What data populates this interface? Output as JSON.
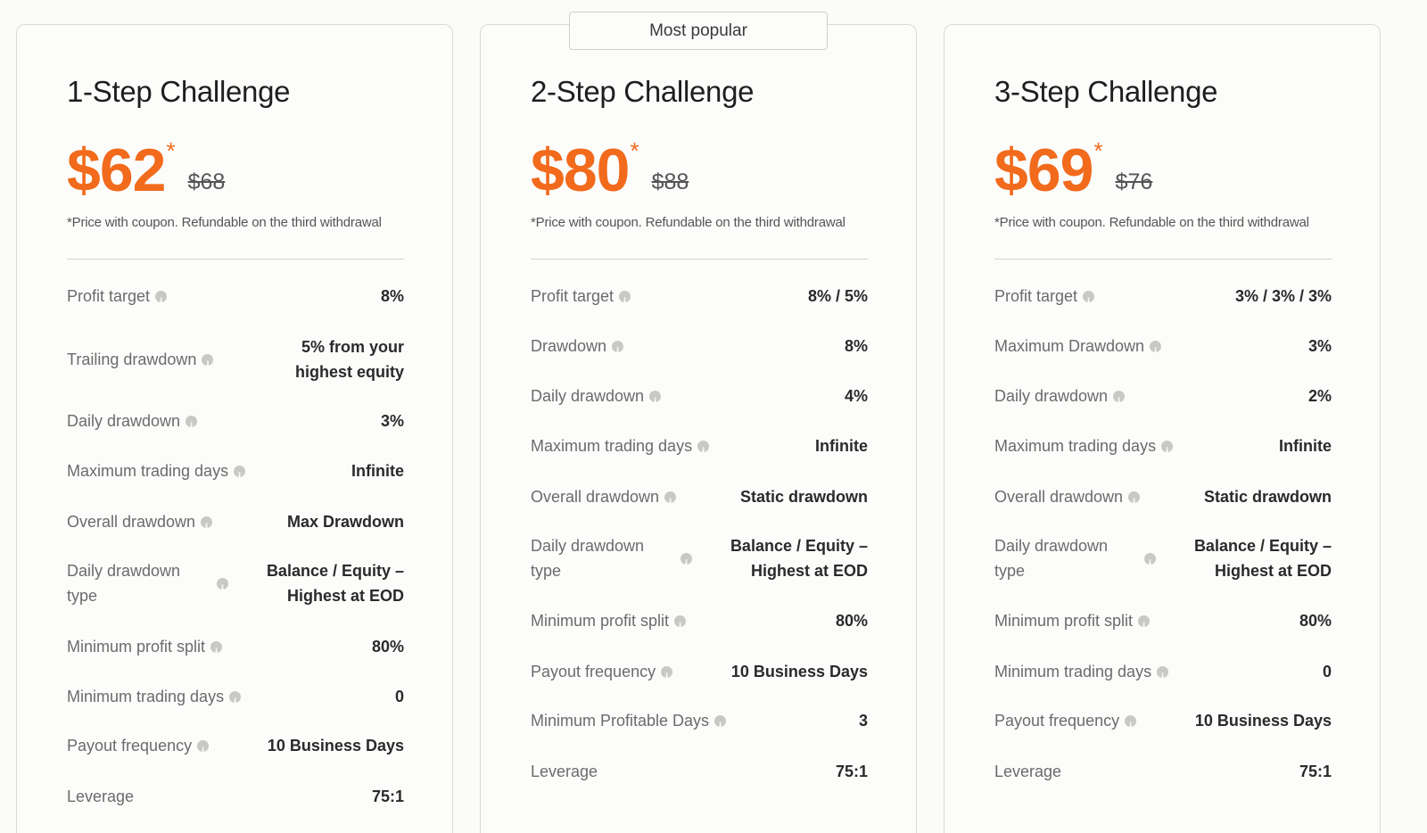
{
  "badge": "Most popular",
  "cards": [
    {
      "title": "1-Step Challenge",
      "price": "$62",
      "star": "*",
      "old_price": "$68",
      "note": "*Price with coupon. Refundable on the third withdrawal",
      "rows": [
        {
          "label": "Profit target",
          "value": "8%"
        },
        {
          "label": "Trailing drawdown",
          "value": "5% from your highest equity"
        },
        {
          "label": "Daily drawdown",
          "value": "3%"
        },
        {
          "label": "Maximum trading days",
          "value": "Infinite"
        },
        {
          "label": "Overall drawdown",
          "value": "Max Drawdown"
        },
        {
          "label": "Daily drawdown type",
          "value": "Balance / Equity – Highest at EOD"
        },
        {
          "label": "Minimum profit split",
          "value": "80%"
        },
        {
          "label": "Minimum trading days",
          "value": "0"
        },
        {
          "label": "Payout frequency",
          "value": "10 Business Days"
        },
        {
          "label": "Leverage",
          "value": "75:1"
        }
      ]
    },
    {
      "title": "2-Step Challenge",
      "price": "$80",
      "star": "*",
      "old_price": "$88",
      "note": "*Price with coupon. Refundable on the third withdrawal",
      "rows": [
        {
          "label": "Profit target",
          "value": "8% / 5%"
        },
        {
          "label": "Drawdown",
          "value": "8%"
        },
        {
          "label": "Daily drawdown",
          "value": "4%"
        },
        {
          "label": "Maximum trading days",
          "value": "Infinite"
        },
        {
          "label": "Overall drawdown",
          "value": "Static drawdown"
        },
        {
          "label": "Daily drawdown type",
          "value": "Balance / Equity – Highest at EOD"
        },
        {
          "label": "Minimum profit split",
          "value": "80%"
        },
        {
          "label": "Payout frequency",
          "value": "10 Business Days"
        },
        {
          "label": "Minimum Profitable Days",
          "value": "3"
        },
        {
          "label": "Leverage",
          "value": "75:1"
        }
      ]
    },
    {
      "title": "3-Step Challenge",
      "price": "$69",
      "star": "*",
      "old_price": "$76",
      "note": "*Price with coupon. Refundable on the third withdrawal",
      "rows": [
        {
          "label": "Profit target",
          "value": "3% / 3% / 3%"
        },
        {
          "label": "Maximum Drawdown",
          "value": "3%"
        },
        {
          "label": "Daily drawdown",
          "value": "2%"
        },
        {
          "label": "Maximum trading days",
          "value": "Infinite"
        },
        {
          "label": "Overall drawdown",
          "value": "Static drawdown"
        },
        {
          "label": "Daily drawdown type",
          "value": "Balance / Equity – Highest at EOD"
        },
        {
          "label": "Minimum profit split",
          "value": "80%"
        },
        {
          "label": "Minimum trading days",
          "value": "0"
        },
        {
          "label": "Payout frequency",
          "value": "10 Business Days"
        },
        {
          "label": "Leverage",
          "value": "75:1"
        }
      ]
    }
  ]
}
